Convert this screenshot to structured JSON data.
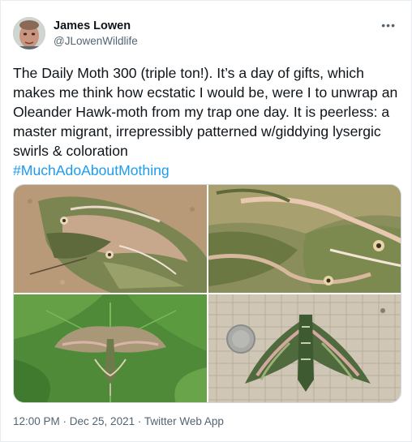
{
  "author": {
    "display_name": "James Lowen",
    "handle": "@JLowenWildlife",
    "avatar_icon": "user-avatar"
  },
  "more_icon": "more-options-icon",
  "tweet": {
    "text": "The Daily Moth 300 (triple ton!). It’s a day of gifts, which makes me think how ecstatic I would be, were I to unwrap an Oleander Hawk-moth from my trap one day. It is peerless: a master migrant, irrepressibly patterned w/giddying lysergic swirls & coloration",
    "hashtag": "#MuchAdoAboutMothing"
  },
  "photos": [
    {
      "subject": "oleander-hawk-moth-on-sand"
    },
    {
      "subject": "oleander-hawk-moth-closeup"
    },
    {
      "subject": "oleander-hawk-moth-on-leaf"
    },
    {
      "subject": "oleander-hawk-moth-with-coin"
    }
  ],
  "footer": {
    "meta": "12:00 PM · Dec 25, 2021 · Twitter Web App"
  },
  "colors": {
    "link": "#1d9bf0",
    "secondary_text": "#536471",
    "primary_text": "#0f1419"
  }
}
